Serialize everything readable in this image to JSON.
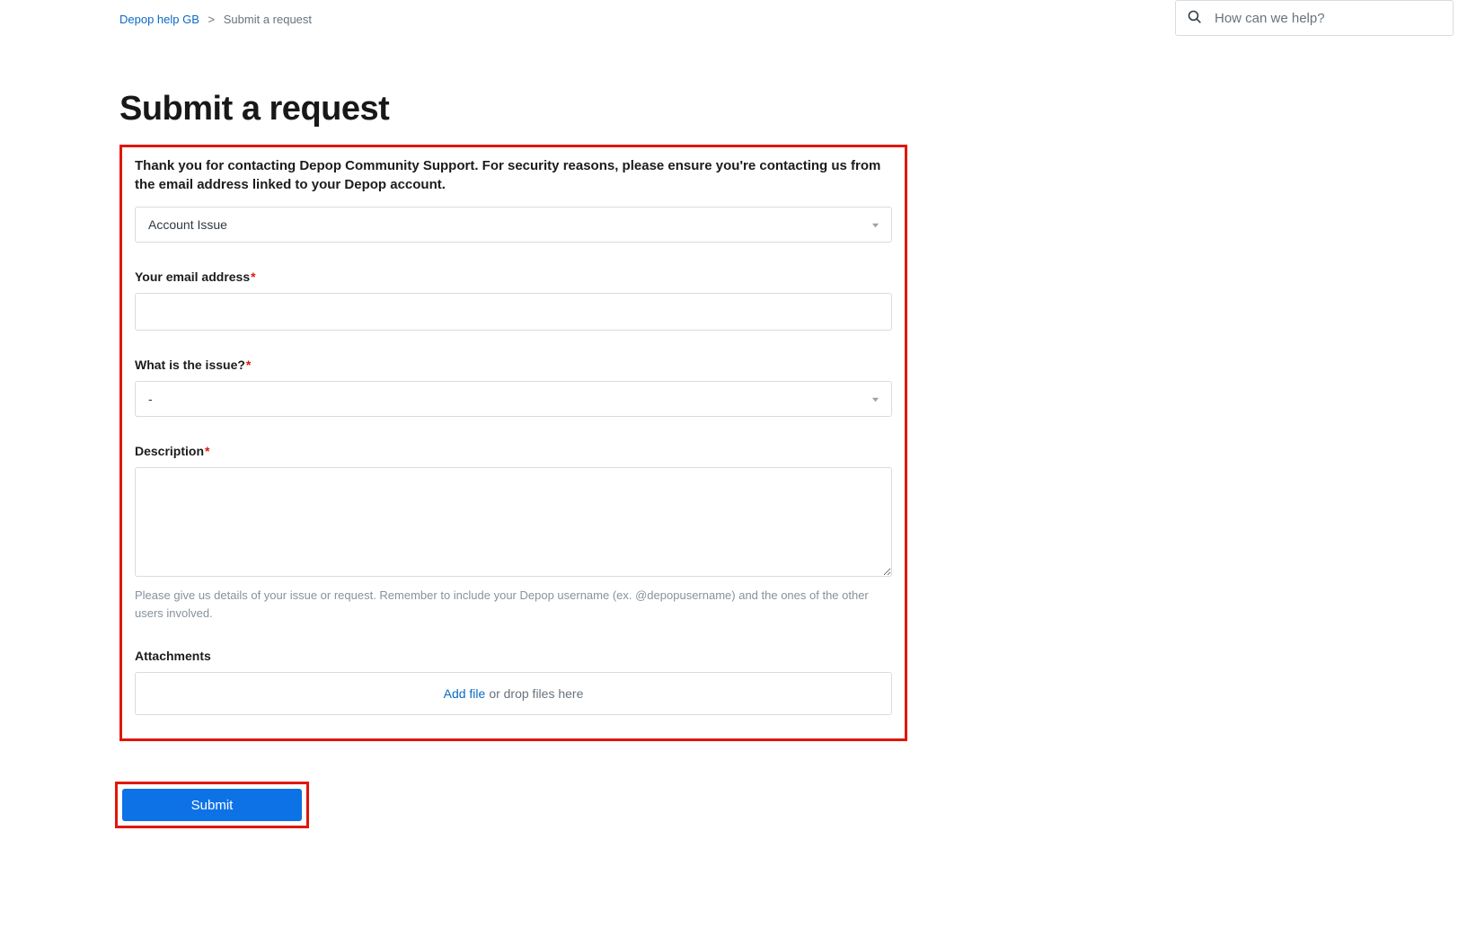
{
  "breadcrumb": {
    "root": "Depop help GB",
    "sep": ">",
    "current": "Submit a request"
  },
  "search": {
    "placeholder": "How can we help?"
  },
  "page": {
    "title": "Submit a request"
  },
  "form": {
    "intro": "Thank you for contacting Depop Community Support. For security reasons, please ensure you're contacting us from the email address linked to your Depop account.",
    "topic": {
      "value": "Account Issue"
    },
    "email": {
      "label": "Your email address",
      "value": ""
    },
    "issue": {
      "label": "What is the issue?",
      "value": "-"
    },
    "description": {
      "label": "Description",
      "value": "",
      "hint": "Please give us details of your issue or request. Remember to include your Depop username (ex. @depopusername) and the ones of the other users involved."
    },
    "attachments": {
      "label": "Attachments",
      "add_file": "Add file",
      "drop_text": "or drop files here"
    },
    "submit_label": "Submit"
  }
}
